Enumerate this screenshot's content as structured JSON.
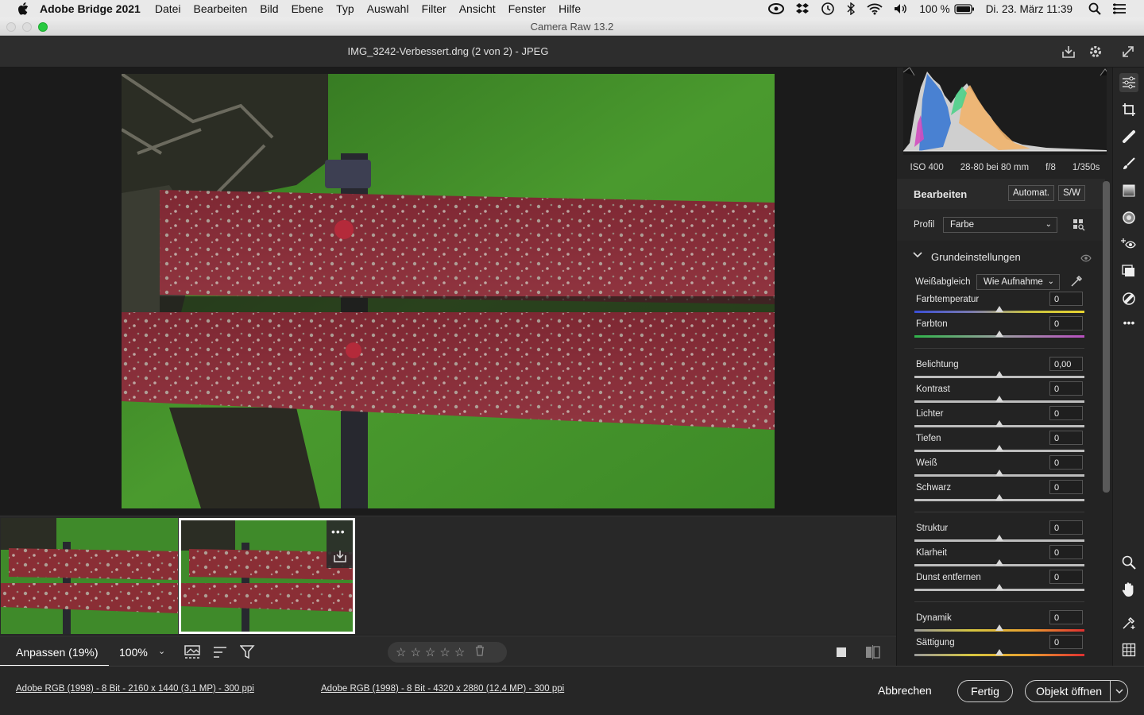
{
  "menubar": {
    "app_name": "Adobe Bridge 2021",
    "items": [
      "Datei",
      "Bearbeiten",
      "Bild",
      "Ebene",
      "Typ",
      "Auswahl",
      "Filter",
      "Ansicht",
      "Fenster",
      "Hilfe"
    ],
    "battery": "100 %",
    "datetime": "Di. 23. März  11:39"
  },
  "window": {
    "title": "Camera Raw 13.2"
  },
  "header": {
    "filename": "IMG_3242-Verbessert.dng (2 von 2)  -  JPEG"
  },
  "histogram": {
    "iso": "ISO 400",
    "lens": "28-80 bei 80 mm",
    "aperture": "f/8",
    "shutter": "1/350s"
  },
  "edit": {
    "title": "Bearbeiten",
    "auto_label": "Automat.",
    "bw_label": "S/W",
    "profile_label": "Profil",
    "profile_value": "Farbe",
    "section_title": "Grundeinstellungen",
    "wb_label": "Weißabgleich",
    "wb_value": "Wie Aufnahme"
  },
  "sliders": [
    {
      "label": "Farbtemperatur",
      "value": "0",
      "type": "temp"
    },
    {
      "label": "Farbton",
      "value": "0",
      "type": "tint"
    },
    {
      "label": "Belichtung",
      "value": "0,00",
      "type": "plain"
    },
    {
      "label": "Kontrast",
      "value": "0",
      "type": "plain"
    },
    {
      "label": "Lichter",
      "value": "0",
      "type": "plain"
    },
    {
      "label": "Tiefen",
      "value": "0",
      "type": "plain"
    },
    {
      "label": "Weiß",
      "value": "0",
      "type": "plain"
    },
    {
      "label": "Schwarz",
      "value": "0",
      "type": "plain"
    },
    {
      "label": "Struktur",
      "value": "0",
      "type": "plain"
    },
    {
      "label": "Klarheit",
      "value": "0",
      "type": "plain"
    },
    {
      "label": "Dunst entfernen",
      "value": "0",
      "type": "plain"
    },
    {
      "label": "Dynamik",
      "value": "0",
      "type": "sat"
    },
    {
      "label": "Sättigung",
      "value": "0",
      "type": "sat"
    }
  ],
  "toolbar": {
    "fit_label": "Anpassen (19%)",
    "zoom_label": "100%"
  },
  "footer": {
    "info1": "Adobe RGB (1998) - 8 Bit - 2160 x 1440 (3,1 MP) - 300 ppi",
    "info2": "Adobe RGB (1998) - 8 Bit - 4320 x 2880 (12,4 MP) - 300 ppi",
    "cancel_label": "Abbrechen",
    "done_label": "Fertig",
    "open_label": "Objekt öffnen"
  },
  "colors": {
    "accent": "#ffffff",
    "panel": "#232323",
    "grass": "#3f8a2a",
    "wood": "#8a2e35"
  }
}
